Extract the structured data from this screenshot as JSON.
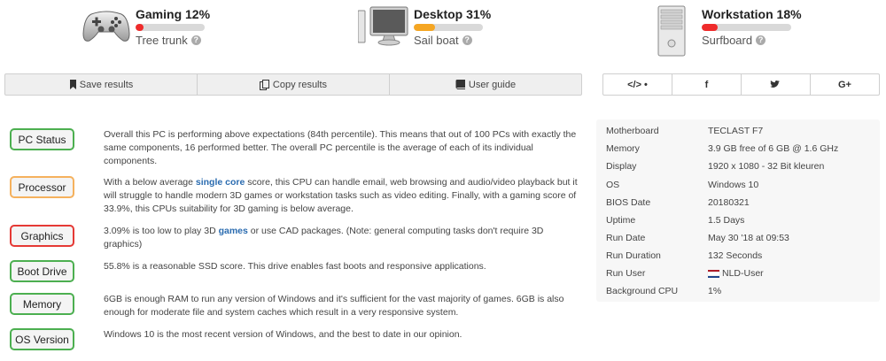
{
  "scores": [
    {
      "title": "Gaming 12%",
      "value": 0.12,
      "label": "Tree trunk",
      "color": "#ef2b2b",
      "icon": "gamepad-icon"
    },
    {
      "title": "Desktop 31%",
      "value": 0.31,
      "label": "Sail boat",
      "color": "#f5a623",
      "icon": "desktop-icon"
    },
    {
      "title": "Workstation 18%",
      "value": 0.18,
      "label": "Surfboard",
      "color": "#ef2b2b",
      "icon": "workstation-icon"
    }
  ],
  "toolbar": {
    "save": "Save results",
    "copy": "Copy results",
    "guide": "User guide"
  },
  "share": {
    "embed": "</> •",
    "facebook": "f",
    "twitter": "•",
    "google": "G+"
  },
  "status": [
    {
      "label": "PC Status",
      "color": "green",
      "text": "Overall this PC is performing above expectations (84th percentile). This means that out of 100 PCs with exactly the same components, 16 performed better. The overall PC percentile is the average of each of its individual components."
    },
    {
      "label": "Processor",
      "color": "orange",
      "pre": "With a below average ",
      "link": "single core",
      "post": " score, this CPU can handle email, web browsing and audio/video playback but it will struggle to handle modern 3D games or workstation tasks such as video editing. Finally, with a gaming score of 33.9%, this CPUs suitability for 3D gaming is below average."
    },
    {
      "label": "Graphics",
      "color": "red",
      "pre": "3.09% is too low to play 3D ",
      "link": "games",
      "post": " or use CAD packages. (Note: general computing tasks don't require 3D graphics)"
    },
    {
      "label": "Boot Drive",
      "color": "green",
      "text": "55.8% is a reasonable SSD score. This drive enables fast boots and responsive applications."
    },
    {
      "label": "Memory",
      "color": "green",
      "text": "6GB is enough RAM to run any version of Windows and it's sufficient for the vast majority of games. 6GB is also enough for moderate file and system caches which result in a very responsive system."
    },
    {
      "label": "OS Version",
      "color": "green",
      "text": "Windows 10 is the most recent version of Windows, and the best to date in our opinion."
    }
  ],
  "sysinfo": [
    {
      "key": "Motherboard",
      "value": "TECLAST F7"
    },
    {
      "key": "Memory",
      "value": "3.9 GB free of 6 GB @ 1.6 GHz"
    },
    {
      "key": "Display",
      "value": "1920 x 1080 - 32 Bit kleuren"
    },
    {
      "key": "OS",
      "value": "Windows 10"
    },
    {
      "key": "BIOS Date",
      "value": "20180321"
    },
    {
      "key": "Uptime",
      "value": "1.5 Days"
    },
    {
      "key": "Run Date",
      "value": "May 30 '18 at 09:53"
    },
    {
      "key": "Run Duration",
      "value": "132 Seconds"
    },
    {
      "key": "Run User",
      "value": "NLD-User",
      "flag": "nl-flag-icon"
    },
    {
      "key": "Background CPU",
      "value": "1%"
    }
  ]
}
